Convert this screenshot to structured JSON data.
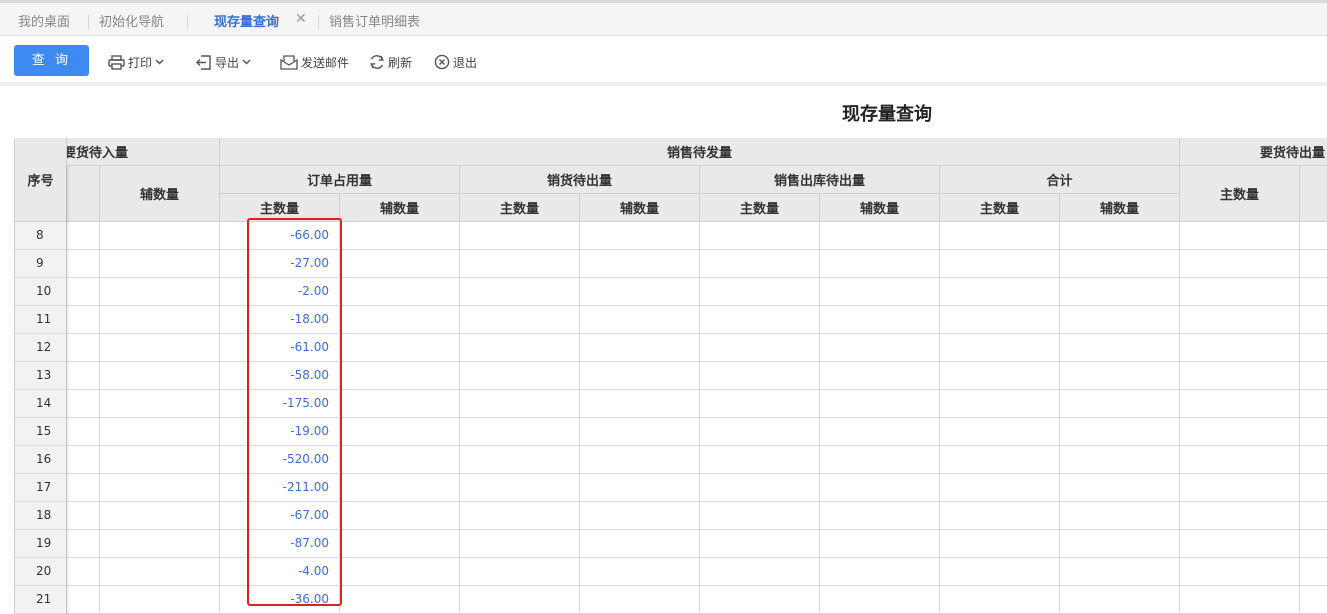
{
  "tabs": [
    {
      "label": "我的桌面"
    },
    {
      "label": "初始化导航"
    },
    {
      "label": "现存量查询",
      "active": true,
      "closable": true
    },
    {
      "label": "销售订单明细表"
    }
  ],
  "toolbar": {
    "query_label": "查 询",
    "print_label": "打印",
    "export_label": "导出",
    "email_label": "发送邮件",
    "refresh_label": "刷新",
    "exit_label": "退出"
  },
  "page_title": "现存量查询",
  "table": {
    "headers": {
      "seq": "序号",
      "group_left": "要货待入量",
      "aux_left": "辅数量",
      "sales_pending": "销售待发量",
      "order_occupied": "订单占用量",
      "sales_to_ship": "销货待出量",
      "sales_out_pending": "销售出库待出量",
      "total": "合计",
      "group_right": "要货待出量",
      "main_right": "主数量",
      "main_qty": "主数量",
      "aux_qty": "辅数量"
    },
    "rows": [
      {
        "seq": "8",
        "order_main": "-66.00"
      },
      {
        "seq": "9",
        "order_main": "-27.00"
      },
      {
        "seq": "10",
        "order_main": "-2.00"
      },
      {
        "seq": "11",
        "order_main": "-18.00"
      },
      {
        "seq": "12",
        "order_main": "-61.00"
      },
      {
        "seq": "13",
        "order_main": "-58.00"
      },
      {
        "seq": "14",
        "order_main": "-175.00"
      },
      {
        "seq": "15",
        "order_main": "-19.00"
      },
      {
        "seq": "16",
        "order_main": "-520.00"
      },
      {
        "seq": "17",
        "order_main": "-211.00"
      },
      {
        "seq": "18",
        "order_main": "-67.00"
      },
      {
        "seq": "19",
        "order_main": "-87.00"
      },
      {
        "seq": "20",
        "order_main": "-4.00"
      },
      {
        "seq": "21",
        "order_main": "-36.00"
      }
    ]
  },
  "colors": {
    "accent": "#3d8bf0",
    "value_text": "#3d6fd6",
    "highlight_border": "#e02020"
  }
}
